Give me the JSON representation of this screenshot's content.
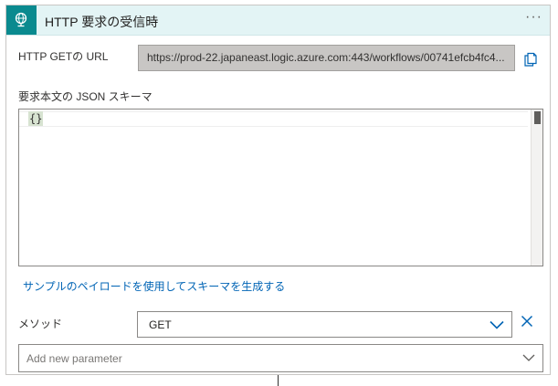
{
  "header": {
    "title": "HTTP 要求の受信時",
    "more_label": "···",
    "icon": "globe-request-icon",
    "icon_bg_color": "#0a8a8f",
    "bg_color": "#e3f4f5"
  },
  "url_field": {
    "label": "HTTP GETの URL",
    "value": "https://prod-22.japaneast.logic.azure.com:443/workflows/00741efcb4fc4...",
    "copy_icon": "copy-icon"
  },
  "schema": {
    "label": "要求本文の JSON スキーマ",
    "content": "{}"
  },
  "sample_link": {
    "label": "サンプルのペイロードを使用してスキーマを生成する",
    "color": "#0064b5"
  },
  "method": {
    "label": "メソッド",
    "value": "GET",
    "chevron_icon": "chevron-down-icon",
    "remove_icon": "close-icon"
  },
  "add_parameter": {
    "placeholder": "Add new parameter",
    "chevron_icon": "chevron-down-icon"
  }
}
